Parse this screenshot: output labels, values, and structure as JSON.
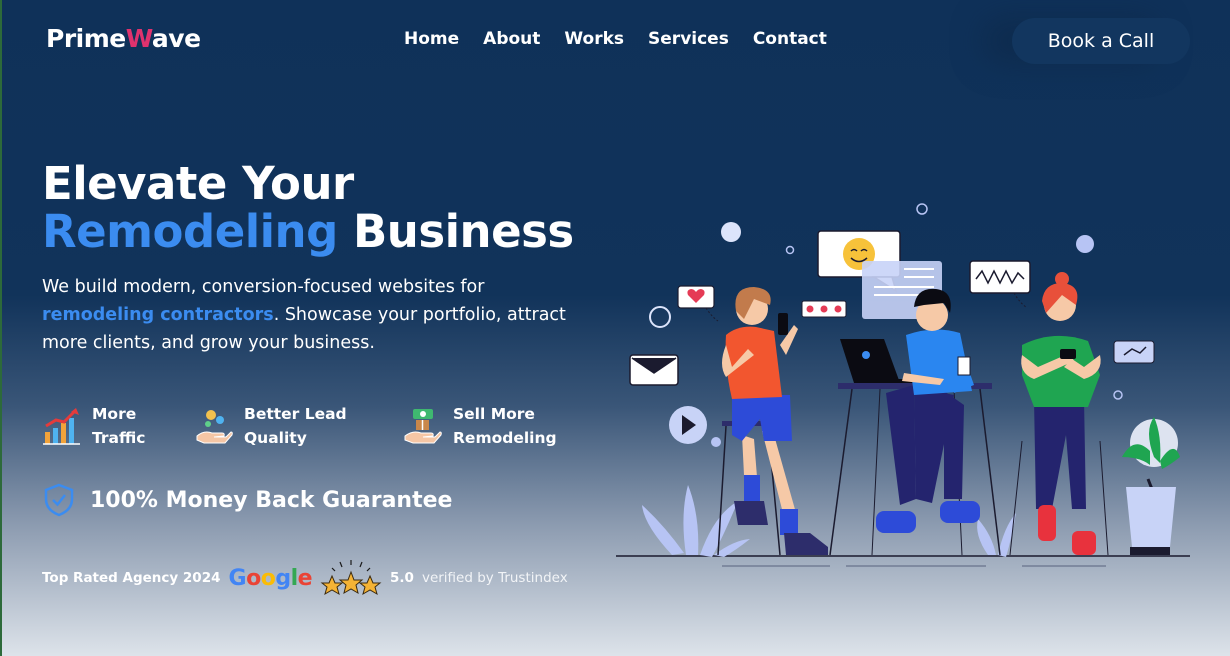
{
  "brand": {
    "name_part1": "Prime",
    "name_accent": "W",
    "name_part2": "ave",
    "colors": {
      "background": "#0f3159",
      "accent_blue": "#3b8cf0",
      "logo_accent": "#e0326e"
    }
  },
  "nav": {
    "items": [
      "Home",
      "About",
      "Works",
      "Services",
      "Contact"
    ],
    "cta": "Book a Call"
  },
  "hero": {
    "headline_line1": "Elevate Your",
    "headline_highlight": "Remodeling",
    "headline_line2_rest": "Business",
    "subtext_before": "We build modern, conversion-focused websites for ",
    "subtext_highlight": "remodeling contractors",
    "subtext_after": ". Showcase your portfolio, attract more clients, and grow your business."
  },
  "features": [
    {
      "line1": "More",
      "line2": "Traffic",
      "icon": "growth-chart-icon"
    },
    {
      "line1": "Better Lead",
      "line2": "Quality",
      "icon": "lead-hand-icon"
    },
    {
      "line1": "Sell More",
      "line2": "Remodeling",
      "icon": "money-hand-icon"
    }
  ],
  "guarantee": {
    "text": "100% Money Back Guarantee",
    "icon": "shield-check-icon"
  },
  "rating": {
    "label": "Top Rated Agency 2024",
    "google": "Google",
    "score": "5.0",
    "verified": "verified by Trustindex"
  }
}
